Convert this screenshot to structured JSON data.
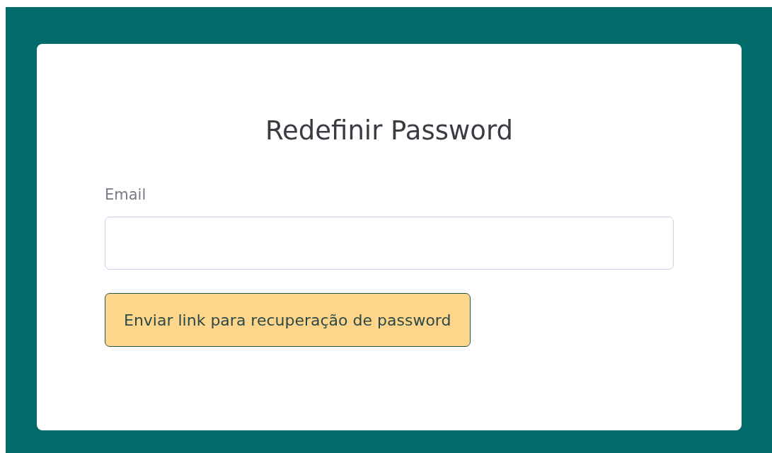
{
  "title": "Redefinir Password",
  "email_field": {
    "label": "Email"
  },
  "submit_button": {
    "label": "Enviar link para recuperação de password"
  }
}
